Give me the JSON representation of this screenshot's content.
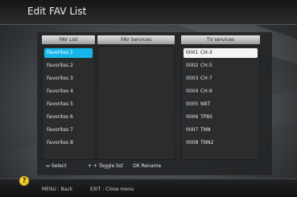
{
  "window": {
    "title": "Edit FAV List"
  },
  "columns": {
    "fav_list": {
      "header": "FAV List",
      "items": [
        "Favorites 1",
        "Favorites 2",
        "Favorites 3",
        "Favorites 4",
        "Favorites 5",
        "Favorites 6",
        "Favorites 7",
        "Favorites 8"
      ],
      "selected_index": 0
    },
    "fav_services": {
      "header": "FAV Services",
      "items": []
    },
    "tv_services": {
      "header": "TV services",
      "items": [
        {
          "num": "0001",
          "name": "CH-3"
        },
        {
          "num": "0002",
          "name": "CH-5"
        },
        {
          "num": "0003",
          "name": "CH-7"
        },
        {
          "num": "0004",
          "name": "CH-9"
        },
        {
          "num": "0005",
          "name": "NBT"
        },
        {
          "num": "0006",
          "name": "TPBS"
        },
        {
          "num": "0007",
          "name": "TNN"
        },
        {
          "num": "0008",
          "name": "TNN2"
        }
      ],
      "selected_index": 0
    }
  },
  "hints": {
    "select": "↔ Select",
    "toggle": "+ + Toggle list",
    "rename": "OK Rename"
  },
  "bottom": {
    "menu": "MENU : Back",
    "exit": "EXIT : Close menu"
  },
  "colors": {
    "accent": "#17b6ea",
    "highlight": "#f4f4f4"
  },
  "icons": {
    "help": "question-icon"
  }
}
